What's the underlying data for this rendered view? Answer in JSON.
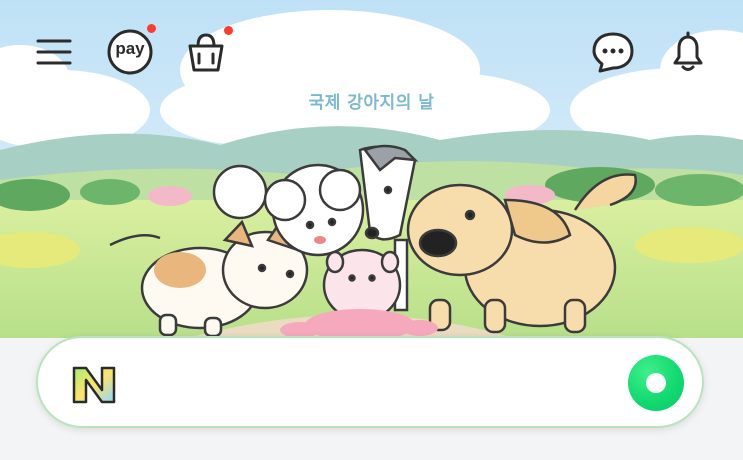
{
  "header": {
    "menu_icon": "menu-icon",
    "pay_label": "pay",
    "cart_icon": "shopping-bag-icon",
    "chat_icon": "chat-bubble-icon",
    "bell_icon": "bell-icon",
    "badge_color": "#ff3b2f"
  },
  "doodle": {
    "title": "국제 강아지의 날"
  },
  "search": {
    "logo_letter": "N",
    "value": "",
    "placeholder": "",
    "action_color": "#10d86f"
  },
  "colors": {
    "sky": "#dcefff",
    "hills": "#a9d48a",
    "field": "#cfe99a",
    "accent_green": "#19d46e"
  }
}
